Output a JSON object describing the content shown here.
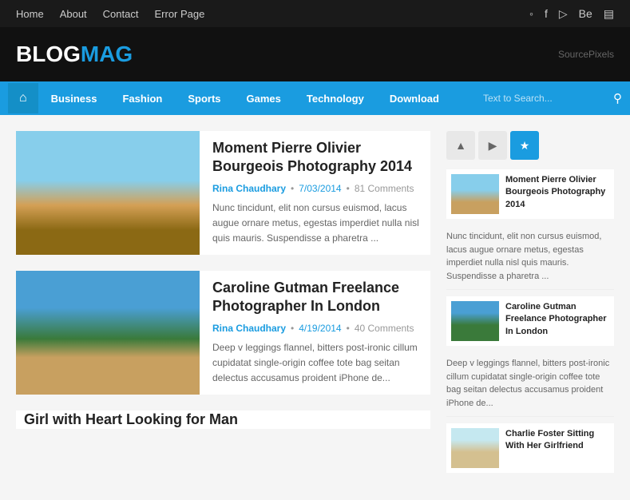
{
  "topnav": {
    "links": [
      {
        "label": "Home",
        "name": "home"
      },
      {
        "label": "About",
        "name": "about"
      },
      {
        "label": "Contact",
        "name": "contact"
      },
      {
        "label": "Error Page",
        "name": "error-page"
      }
    ],
    "icons": [
      "globe-icon",
      "facebook-icon",
      "pinterest-icon",
      "behance-icon",
      "camera-icon"
    ]
  },
  "header": {
    "logo_blog": "BLOG",
    "logo_mag": "MAG",
    "source": "SourcePixels"
  },
  "mainnav": {
    "links": [
      {
        "label": "Business",
        "name": "business"
      },
      {
        "label": "Fashion",
        "name": "fashion"
      },
      {
        "label": "Sports",
        "name": "sports"
      },
      {
        "label": "Games",
        "name": "games"
      },
      {
        "label": "Technology",
        "name": "technology"
      },
      {
        "label": "Download",
        "name": "download"
      }
    ],
    "search_placeholder": "Text to Search..."
  },
  "articles": [
    {
      "title": "Moment Pierre Olivier Bourgeois Photography 2014",
      "author": "Rina Chaudhary",
      "date": "7/03/2014",
      "comments": "81 Comments",
      "excerpt": "Nunc tincidunt, elit non cursus euismod, lacus augue ornare metus, egestas imperdiet nulla nisl quis mauris. Suspendisse a pharetra ..."
    },
    {
      "title": "Caroline Gutman Freelance Photographer In London",
      "author": "Rina Chaudhary",
      "date": "4/19/2014",
      "comments": "40 Comments",
      "excerpt": "Deep v leggings flannel, bitters post-ironic cillum cupidatat single-origin coffee tote bag seitan delectus accusamus proident iPhone de..."
    },
    {
      "title": "Girl with Heart Looking for Man",
      "author": "",
      "date": "",
      "comments": "",
      "excerpt": ""
    }
  ],
  "sidebar": {
    "tabs": [
      {
        "icon": "tag-icon",
        "active": false
      },
      {
        "icon": "video-icon",
        "active": false
      },
      {
        "icon": "star-icon",
        "active": true
      }
    ],
    "posts": [
      {
        "title": "Moment Pierre Olivier Bourgeois Photography 2014",
        "excerpt": "Nunc tincidunt, elit non cursus euismod, lacus augue ornare metus, egestas imperdiet nulla nisl quis mauris. Suspendisse a pharetra ..."
      },
      {
        "title": "Caroline Gutman Freelance Photographer In London",
        "excerpt": "Deep v leggings flannel, bitters post-ironic cillum cupidatat single-origin coffee tote bag seitan delectus accusamus proident iPhone de..."
      },
      {
        "title": "Charlie Foster Sitting With Her Girlfriend",
        "excerpt": ""
      }
    ]
  }
}
